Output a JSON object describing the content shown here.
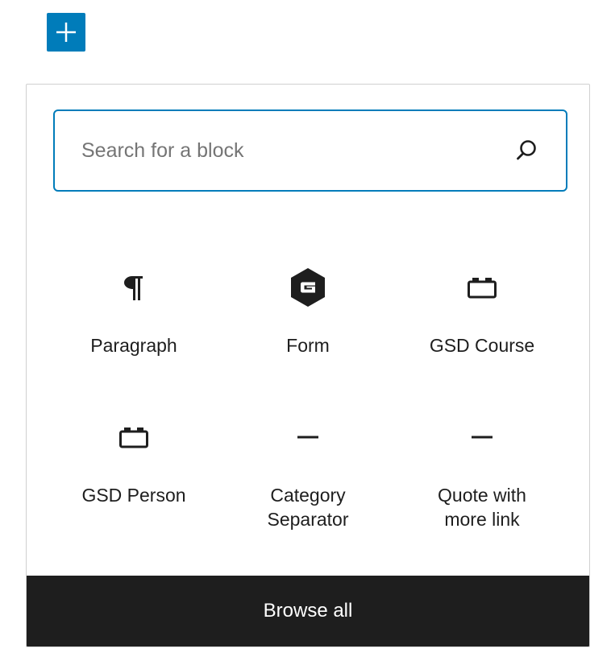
{
  "toolbar": {
    "add_block_icon": "plus-icon",
    "accent_color": "#007cba"
  },
  "inserter": {
    "search": {
      "placeholder": "Search for a block",
      "value": "",
      "icon": "search-icon"
    },
    "blocks": [
      {
        "label": "Paragraph",
        "icon": "pilcrow-icon"
      },
      {
        "label": "Form",
        "icon": "gravity-forms-icon"
      },
      {
        "label": "GSD Course",
        "icon": "block-default-icon"
      },
      {
        "label": "GSD Person",
        "icon": "block-default-icon"
      },
      {
        "label": "Category Separator",
        "icon": "separator-icon"
      },
      {
        "label": "Quote with more link",
        "icon": "separator-icon"
      }
    ],
    "browse_all_label": "Browse all"
  }
}
